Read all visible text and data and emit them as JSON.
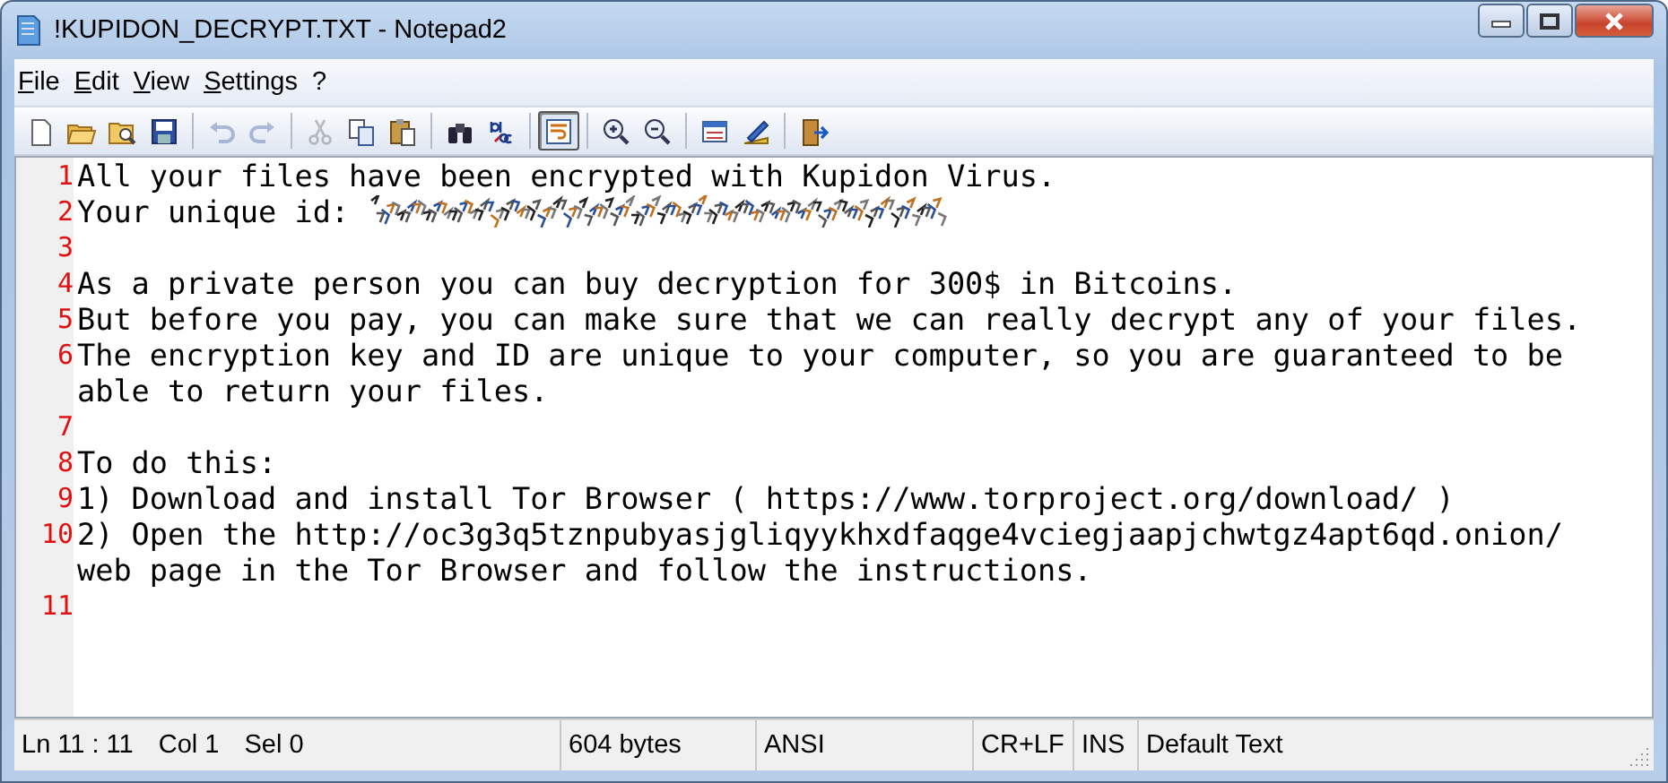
{
  "window": {
    "title": "!KUPIDON_DECRYPT.TXT - Notepad2"
  },
  "menu": [
    {
      "label": "File"
    },
    {
      "label": "Edit"
    },
    {
      "label": "View"
    },
    {
      "label": "Settings"
    },
    {
      "label": "?"
    }
  ],
  "toolbar": [
    {
      "kind": "new",
      "disabled": false,
      "pressed": false
    },
    {
      "kind": "open",
      "disabled": false,
      "pressed": false
    },
    {
      "kind": "browse",
      "disabled": false,
      "pressed": false
    },
    {
      "kind": "save",
      "disabled": false,
      "pressed": false
    },
    {
      "kind": "separator"
    },
    {
      "kind": "undo",
      "disabled": true,
      "pressed": false
    },
    {
      "kind": "redo",
      "disabled": true,
      "pressed": false
    },
    {
      "kind": "separator"
    },
    {
      "kind": "cut",
      "disabled": true,
      "pressed": false
    },
    {
      "kind": "copy",
      "disabled": false,
      "pressed": false
    },
    {
      "kind": "paste",
      "disabled": false,
      "pressed": false
    },
    {
      "kind": "separator"
    },
    {
      "kind": "find",
      "disabled": false,
      "pressed": false
    },
    {
      "kind": "replace",
      "disabled": false,
      "pressed": false
    },
    {
      "kind": "separator"
    },
    {
      "kind": "wrap",
      "disabled": false,
      "pressed": true
    },
    {
      "kind": "separator"
    },
    {
      "kind": "zoom-in",
      "disabled": false,
      "pressed": false
    },
    {
      "kind": "zoom-out",
      "disabled": false,
      "pressed": false
    },
    {
      "kind": "separator"
    },
    {
      "kind": "scheme",
      "disabled": false,
      "pressed": false
    },
    {
      "kind": "customize",
      "disabled": false,
      "pressed": false
    },
    {
      "kind": "separator"
    },
    {
      "kind": "exit",
      "disabled": false,
      "pressed": false
    }
  ],
  "editor": {
    "lines": [
      {
        "number": "1",
        "rows": [
          "All your files have been encrypted with Kupidon Virus."
        ]
      },
      {
        "number": "2",
        "rows": [
          "Your unique id: "
        ],
        "redacted": true
      },
      {
        "number": "3",
        "rows": [
          ""
        ]
      },
      {
        "number": "4",
        "rows": [
          "As a private person you can buy decryption for 300$ in Bitcoins."
        ]
      },
      {
        "number": "5",
        "rows": [
          "But before you pay, you can make sure that we can really decrypt any of your files."
        ]
      },
      {
        "number": "6",
        "rows": [
          "The encryption key and ID are unique to your computer, so you are guaranteed to be",
          "able to return your files."
        ]
      },
      {
        "number": "7",
        "rows": [
          ""
        ]
      },
      {
        "number": "8",
        "rows": [
          "To do this:"
        ]
      },
      {
        "number": "9",
        "rows": [
          "1) Download and install Tor Browser ( https://www.torproject.org/download/ )"
        ]
      },
      {
        "number": "10",
        "rows": [
          "2) Open the http://oc3g3q5tznpubyasjgliqyykhxdfaqge4vciegjaapjchwtgz4apt6qd.onion/",
          "web page in the Tor Browser and follow the instructions."
        ]
      },
      {
        "number": "11",
        "rows": [
          ""
        ]
      }
    ]
  },
  "status_bar": [
    {
      "items": [
        "Ln 11 : 11",
        "Col 1",
        "Sel 0"
      ]
    },
    {
      "items": [
        "604 bytes"
      ]
    },
    {
      "items": [
        "ANSI"
      ]
    },
    {
      "items": [
        "CR+LF"
      ]
    },
    {
      "items": [
        "INS"
      ]
    },
    {
      "items": [
        "Default Text"
      ]
    }
  ]
}
